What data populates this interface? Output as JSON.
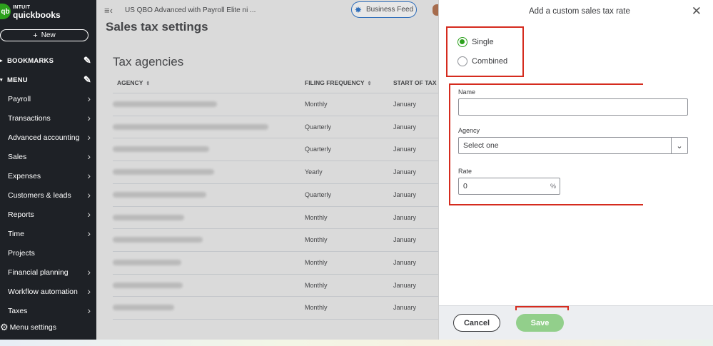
{
  "brand": {
    "intuit": "INTUIT",
    "product": "quickbooks",
    "logo_mark": "qb"
  },
  "sidebar": {
    "new_label": "New",
    "bookmarks_label": "BOOKMARKS",
    "menu_label": "MENU",
    "items": [
      {
        "label": "Payroll",
        "chevron": true
      },
      {
        "label": "Transactions",
        "chevron": true
      },
      {
        "label": "Advanced accounting",
        "chevron": true
      },
      {
        "label": "Sales",
        "chevron": true
      },
      {
        "label": "Expenses",
        "chevron": true
      },
      {
        "label": "Customers & leads",
        "chevron": true
      },
      {
        "label": "Reports",
        "chevron": true
      },
      {
        "label": "Time",
        "chevron": true
      },
      {
        "label": "Projects",
        "chevron": false
      },
      {
        "label": "Financial planning",
        "chevron": true
      },
      {
        "label": "Workflow automation",
        "chevron": true
      },
      {
        "label": "Taxes",
        "chevron": true
      }
    ],
    "menu_settings_label": "Menu settings"
  },
  "topbar": {
    "company_name": "US QBO Advanced with Payroll Elite ni ...",
    "business_feed_label": "Business Feed"
  },
  "page": {
    "title": "Sales tax settings",
    "section_title": "Tax agencies",
    "columns": {
      "agency": "AGENCY",
      "filing_frequency": "FILING FREQUENCY",
      "start_period": "START OF TAX PI"
    },
    "rows": [
      {
        "filing_frequency": "Monthly",
        "start": "January"
      },
      {
        "filing_frequency": "Quarterly",
        "start": "January"
      },
      {
        "filing_frequency": "Quarterly",
        "start": "January"
      },
      {
        "filing_frequency": "Yearly",
        "start": "January"
      },
      {
        "filing_frequency": "Quarterly",
        "start": "January"
      },
      {
        "filing_frequency": "Monthly",
        "start": "January"
      },
      {
        "filing_frequency": "Monthly",
        "start": "January"
      },
      {
        "filing_frequency": "Monthly",
        "start": "January"
      },
      {
        "filing_frequency": "Monthly",
        "start": "January"
      },
      {
        "filing_frequency": "Monthly",
        "start": "January"
      }
    ]
  },
  "drawer": {
    "title": "Add a custom sales tax rate",
    "radio_single": "Single",
    "radio_combined": "Combined",
    "selected": "Single",
    "name_label": "Name",
    "name_value": "",
    "agency_label": "Agency",
    "agency_value": "Select one",
    "rate_label": "Rate",
    "rate_value": "0",
    "rate_unit": "%",
    "cancel_label": "Cancel",
    "save_label": "Save"
  },
  "colors": {
    "sidebar_bg": "#1e2126",
    "brand_green": "#2ca01c",
    "save_disabled": "#92cf8b",
    "annotation_red": "#d52b1e",
    "business_feed_border": "#1f6cc8"
  },
  "icons": {
    "menu_toggle": "menu-collapse-icon",
    "business_feed": "sparkle-icon",
    "pencil": "pencil-icon",
    "chevron": "chevron-right-icon",
    "gear": "gear-icon",
    "close": "close-icon",
    "dropdown": "chevron-down-icon",
    "sort": "sort-icon"
  }
}
